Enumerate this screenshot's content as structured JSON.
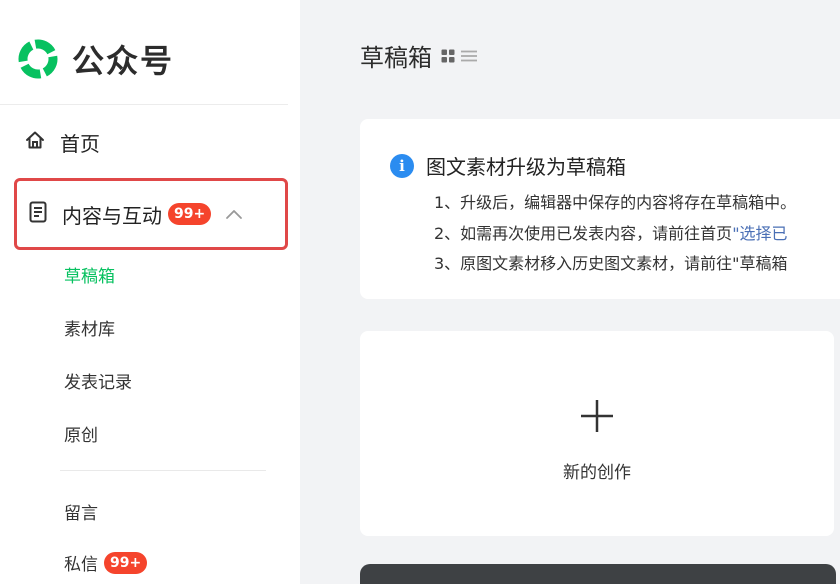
{
  "app": {
    "name": "公众号"
  },
  "sidebar": {
    "home": {
      "label": "首页",
      "icon": "home-icon"
    },
    "content": {
      "label": "内容与互动",
      "badge": "99+",
      "icon": "document-icon",
      "expanded": true,
      "items": [
        {
          "label": "草稿箱",
          "active": true
        },
        {
          "label": "素材库",
          "active": false
        },
        {
          "label": "发表记录",
          "active": false
        },
        {
          "label": "原创",
          "active": false
        }
      ]
    },
    "comments": {
      "label": "留言"
    },
    "messages": {
      "label": "私信",
      "badge": "99+"
    }
  },
  "main": {
    "title": "草稿箱",
    "notice": {
      "title": "图文素材升级为草稿箱",
      "lines": [
        {
          "text": "1、升级后，编辑器中保存的内容将存在草稿箱中。"
        },
        {
          "text": "2、如需再次使用已发表内容，请前往首页",
          "link": "\"选择已"
        },
        {
          "text": "3、原图文素材移入历史图文素材，请前往\"草稿箱"
        }
      ]
    },
    "create": {
      "label": "新的创作"
    }
  },
  "colors": {
    "accent_green": "#07c160",
    "badge_red": "#f5442c",
    "highlight_border": "#e04848",
    "info_blue": "#2b8cf0",
    "link_blue": "#4a6fb5"
  }
}
